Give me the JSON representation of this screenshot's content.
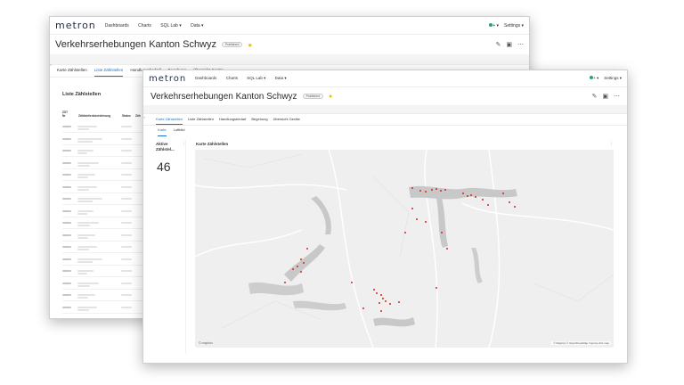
{
  "back": {
    "logo": "metron",
    "nav": [
      "Dashboards",
      "Charts",
      "SQL Lab ▾",
      "Data ▾"
    ],
    "plus": "+ ▾",
    "settings": "Settings ▾",
    "title": "Verkehrserhebungen Kanton Schwyz",
    "badge": "Published",
    "tabs": [
      "Karte Zählstellen",
      "Liste Zählstellen",
      "Handlungsbedarf",
      "Begehung",
      "Übersicht Geräte"
    ],
    "active_tab": 1,
    "panel_title": "Liste Zählstellen",
    "col_zst": "ZST",
    "col_nr": "Nr",
    "col_name": "Zählstellenbezeichnung",
    "col_status": "Status",
    "col_zah": "Zäh"
  },
  "front": {
    "logo": "metron",
    "nav": [
      "Dashboards",
      "Charts",
      "SQL Lab ▾",
      "Data ▾"
    ],
    "plus": "+ ▾",
    "settings": "Settings ▾",
    "title": "Verkehrserhebungen Kanton Schwyz",
    "badge": "Published",
    "tabs": [
      "Karte Zählstellen",
      "Liste Zählstellen",
      "Handlungsbedarf",
      "Begehung",
      "Übersicht Geräte"
    ],
    "active_tab": 0,
    "subtabs": [
      "Karte",
      "Luftbild"
    ],
    "active_subtab": 0,
    "kpi_title": "Aktive Zählstel...",
    "kpi_value": "46",
    "map_title": "Karte Zählstellen",
    "mapbox": "© mapbox",
    "attribution": "© Mapbox © OpenStreetMap Improve this map"
  },
  "colors": {
    "accent": "#1a73c9",
    "marker": "#e0201f",
    "star": "#f2c200",
    "status": "#2aa56a"
  }
}
